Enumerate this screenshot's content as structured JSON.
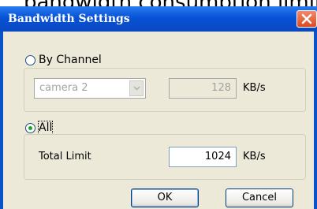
{
  "background": {
    "text": "bandwidth consumption limit."
  },
  "dialog": {
    "title": "Bandwidth Settings",
    "close_icon": "close-icon",
    "by_channel": {
      "label": "By Channel",
      "selected": false,
      "channel_select": {
        "value": "camera 2",
        "enabled": false
      },
      "limit_value": "128",
      "unit": "KB/s"
    },
    "all": {
      "label": "All",
      "selected": true,
      "total_limit_label": "Total Limit",
      "total_limit_value": "1024",
      "unit": "KB/s"
    },
    "buttons": {
      "ok": "OK",
      "cancel": "Cancel"
    }
  },
  "colors": {
    "titlebar": "#0752d6",
    "close": "#e0491f",
    "client": "#ece9d8",
    "radio_dot": "#21a121"
  }
}
